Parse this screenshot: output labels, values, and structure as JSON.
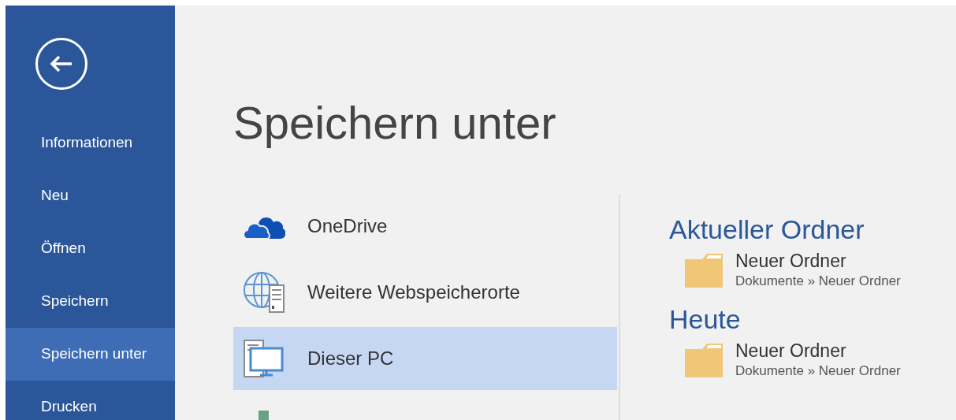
{
  "sidebar": {
    "items": [
      {
        "label": "Informationen",
        "selected": false
      },
      {
        "label": "Neu",
        "selected": false
      },
      {
        "label": "Öffnen",
        "selected": false
      },
      {
        "label": "Speichern",
        "selected": false
      },
      {
        "label": "Speichern unter",
        "selected": true
      },
      {
        "label": "Drucken",
        "selected": false
      }
    ]
  },
  "title": "Speichern unter",
  "locations": [
    {
      "kind": "onedrive",
      "label": "OneDrive",
      "selected": false
    },
    {
      "kind": "web",
      "label": "Weitere Webspeicherorte",
      "selected": false
    },
    {
      "kind": "pc",
      "label": "Dieser PC",
      "selected": true
    },
    {
      "kind": "cutoff",
      "selected": false
    }
  ],
  "folder_groups": [
    {
      "heading": "Aktueller Ordner",
      "folders": [
        {
          "name": "Neuer Ordner",
          "path": "Dokumente » Neuer Ordner"
        }
      ]
    },
    {
      "heading": "Heute",
      "folders": [
        {
          "name": "Neuer Ordner",
          "path": "Dokumente » Neuer Ordner"
        }
      ]
    }
  ]
}
